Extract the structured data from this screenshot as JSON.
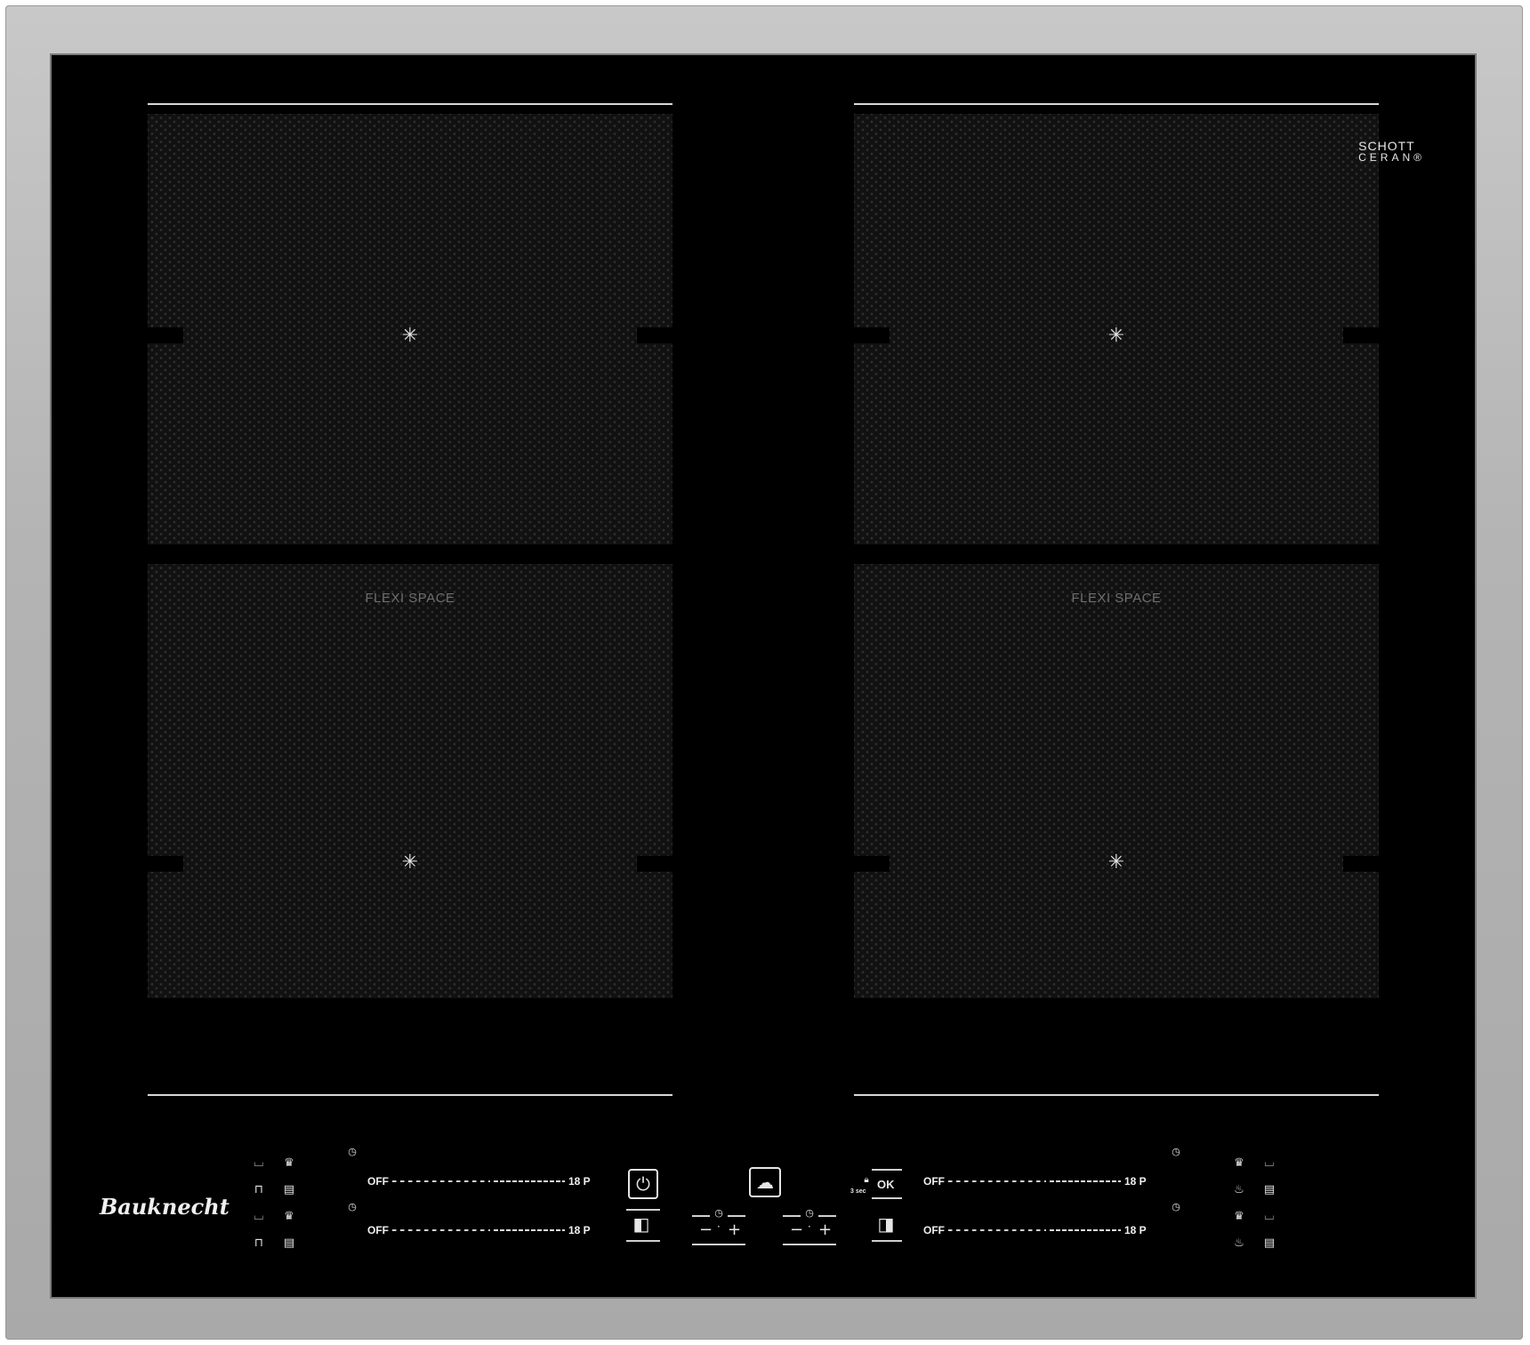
{
  "brand": {
    "logo_text": "Bauknecht"
  },
  "glass_brand": {
    "line1": "SCHOTT",
    "line2": "CERAN"
  },
  "zones": {
    "left_label": "FLEXI SPACE",
    "right_label": "FLEXI SPACE"
  },
  "sliders": {
    "off_label": "OFF",
    "max_label": "18 P"
  },
  "center_controls": {
    "lock_time": "3 sec",
    "ok_label": "OK"
  },
  "icons": {
    "power": "power-icon",
    "timer": "timer-icon",
    "flexi": "flexi-zone-icon",
    "chef": "chef-hat-icon",
    "lock": "lock-icon"
  },
  "colors": {
    "frame": "#b4b4b4",
    "glass": "#000000",
    "print": "#e6e6e6"
  }
}
